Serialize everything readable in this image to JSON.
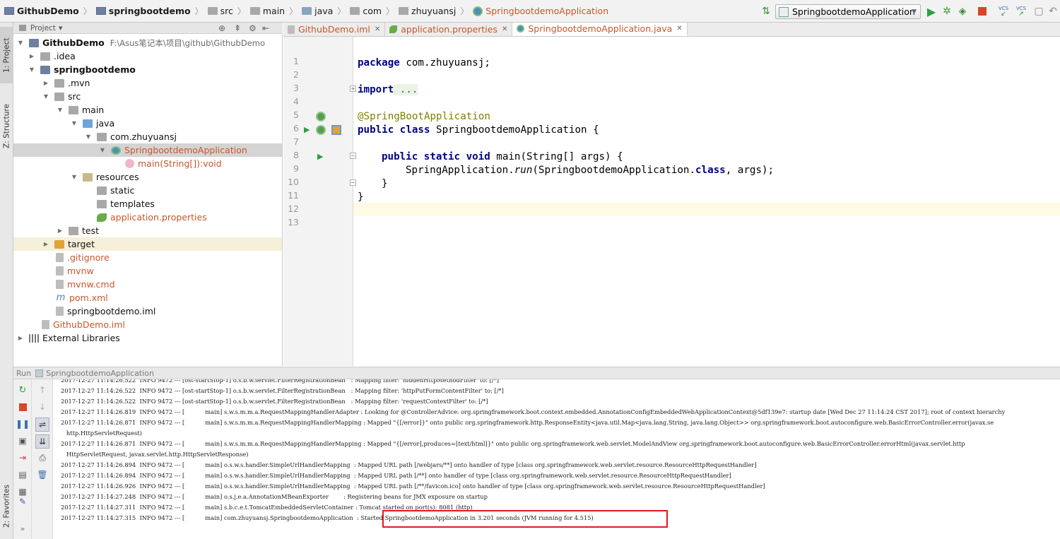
{
  "navbar": {
    "crumbs": [
      "GithubDemo",
      "springbootdemo",
      "src",
      "main",
      "java",
      "com",
      "zhuyuansj",
      "SpringbootdemoApplication"
    ],
    "run_config": "SpringbootdemoApplication",
    "vcs_label": "VCS"
  },
  "left_strip": {
    "project_tab": "1: Project",
    "structure_tab": "Z: Structure",
    "favorites_tab": "2: Favorites"
  },
  "project": {
    "header": "Project",
    "root_path": "F:\\Asus笔记本\\项目\\github\\GithubDemo",
    "tree": [
      {
        "label": "GithubDemo"
      },
      {
        "label": ".idea"
      },
      {
        "label": "springbootdemo"
      },
      {
        "label": ".mvn"
      },
      {
        "label": "src"
      },
      {
        "label": "main"
      },
      {
        "label": "java"
      },
      {
        "label": "com.zhuyuansj"
      },
      {
        "label": "SpringbootdemoApplication"
      },
      {
        "label": "main(String[]):void"
      },
      {
        "label": "resources"
      },
      {
        "label": "static"
      },
      {
        "label": "templates"
      },
      {
        "label": "application.properties"
      },
      {
        "label": "test"
      },
      {
        "label": "target"
      },
      {
        "label": ".gitignore"
      },
      {
        "label": "mvnw"
      },
      {
        "label": "mvnw.cmd"
      },
      {
        "label": "pom.xml"
      },
      {
        "label": "springbootdemo.iml"
      },
      {
        "label": "GithubDemo.iml"
      },
      {
        "label": "External Libraries"
      }
    ]
  },
  "tabs": [
    "GithubDemo.iml",
    "application.properties",
    "SpringbootdemoApplication.java"
  ],
  "editor": {
    "line_numbers": [
      "1",
      "2",
      "3",
      "4",
      "5",
      "6",
      "7",
      "8",
      "9",
      "10",
      "11",
      "12",
      "13"
    ],
    "code": {
      "l1_kw": "package",
      "l1_rest": " com.zhuyuansj;",
      "l3_kw": "import",
      "l3_rest": " ...",
      "l6": "@SpringBootApplication",
      "l7_kw": "public class",
      "l7_rest": " SpringbootdemoApplication {",
      "l9_kw": "public static void",
      "l9_rest": " main(String[] args) {",
      "l10_a": "SpringApplication.",
      "l10_b": "run",
      "l10_c": "(SpringbootdemoApplication.",
      "l10_d": "class",
      "l10_e": ", args);",
      "l11": "}",
      "l12": "}"
    }
  },
  "run": {
    "label": "Run",
    "config": "SpringbootdemoApplication",
    "log": [
      "2017-12-27 11:14:26.522  INFO 9472 --- [ost-startStop-1] o.s.b.w.servlet.FilterRegistrationBean   : Mapping filter: 'hiddenHttpMethodFilter' to: [/*]",
      "2017-12-27 11:14:26.522  INFO 9472 --- [ost-startStop-1] o.s.b.w.servlet.FilterRegistrationBean   : Mapping filter: 'httpPutFormContentFilter' to: [/*]",
      "2017-12-27 11:14:26.522  INFO 9472 --- [ost-startStop-1] o.s.b.w.servlet.FilterRegistrationBean   : Mapping filter: 'requestContextFilter' to: [/*]",
      "2017-12-27 11:14:26.819  INFO 9472 --- [           main] s.w.s.m.m.a.RequestMappingHandlerAdapter : Looking for @ControllerAdvice: org.springframework.boot.context.embedded.AnnotationConfigEmbeddedWebApplicationContext@5df139e7: startup date [Wed Dec 27 11:14:24 CST 2017]; root of context hierarchy",
      "2017-12-27 11:14:26.871  INFO 9472 --- [           main] s.w.s.m.m.a.RequestMappingHandlerMapping : Mapped \"{[/error]}\" onto public org.springframework.http.ResponseEntity<java.util.Map<java.lang.String, java.lang.Object>> org.springframework.boot.autoconfigure.web.BasicErrorController.error(javax.se",
      "   http.HttpServletRequest)",
      "2017-12-27 11:14:26.871  INFO 9472 --- [           main] s.w.s.m.m.a.RequestMappingHandlerMapping : Mapped \"{[/error],produces=[text/html]}\" onto public org.springframework.web.servlet.ModelAndView org.springframework.boot.autoconfigure.web.BasicErrorController.errorHtml(javax.servlet.http",
      "   HttpServletRequest, javax.servlet.http.HttpServletResponse)",
      "2017-12-27 11:14:26.894  INFO 9472 --- [           main] o.s.w.s.handler.SimpleUrlHandlerMapping  : Mapped URL path [/webjars/**] onto handler of type [class org.springframework.web.servlet.resource.ResourceHttpRequestHandler]",
      "2017-12-27 11:14:26.894  INFO 9472 --- [           main] o.s.w.s.handler.SimpleUrlHandlerMapping  : Mapped URL path [/**] onto handler of type [class org.springframework.web.servlet.resource.ResourceHttpRequestHandler]",
      "2017-12-27 11:14:26.926  INFO 9472 --- [           main] o.s.w.s.handler.SimpleUrlHandlerMapping  : Mapped URL path [/**/favicon.ico] onto handler of type [class org.springframework.web.servlet.resource.ResourceHttpRequestHandler]",
      "2017-12-27 11:14:27.248  INFO 9472 --- [           main] o.s.j.e.a.AnnotationMBeanExporter        : Registering beans for JMX exposure on startup",
      "2017-12-27 11:14:27.311  INFO 9472 --- [           main] s.b.c.e.t.TomcatEmbeddedServletContainer : Tomcat started on port(s): 8081 (http)",
      "2017-12-27 11:14:27.315  INFO 9472 --- [           main] com.zhuyuansj.SpringbootdemoApplication  : Started SpringbootdemoApplication in 3.201 seconds (JVM running for 4.515)"
    ]
  }
}
